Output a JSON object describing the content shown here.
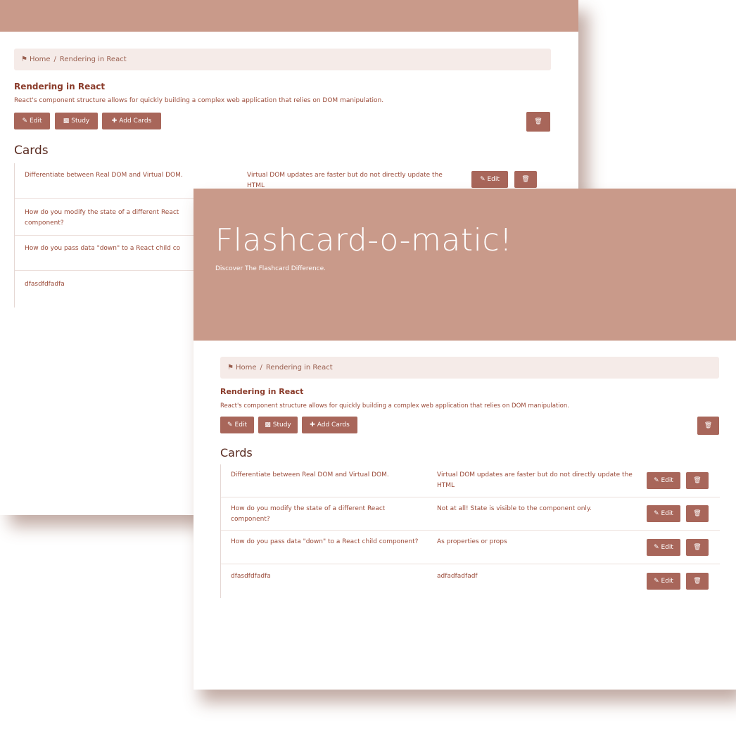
{
  "app": {
    "title": "Flashcard-o-matic!",
    "subtitle": "Discover The Flashcard Difference."
  },
  "breadcrumb": {
    "home_icon": "home-icon",
    "home": "Home",
    "separator": "/",
    "current": "Rendering in React"
  },
  "deck": {
    "name": "Rendering in React",
    "description": "React's component structure allows for quickly building a complex web application that relies on DOM manipulation.",
    "edit_label": "Edit",
    "study_label": "Study",
    "add_cards_label": "Add Cards",
    "delete_icon": "trash-icon"
  },
  "cards_heading": "Cards",
  "cards": [
    {
      "front": "Differentiate between Real DOM and Virtual DOM.",
      "back": "Virtual DOM updates are faster but do not directly update the HTML",
      "edit_label": "Edit"
    },
    {
      "front": "How do you modify the state of a different React component?",
      "back": "Not at all! State is visible to the component only.",
      "edit_label": "Edit"
    },
    {
      "front": "How do you pass data \"down\" to a React child component?",
      "back": "As properties or props",
      "edit_label": "Edit"
    },
    {
      "front": "dfasdfdfadfa",
      "back": "adfadfadfadf",
      "edit_label": "Edit"
    }
  ],
  "back_window_cards": [
    {
      "front": "Differentiate between Real DOM and Virtual DOM.",
      "back": "Virtual DOM updates are faster but do not directly update the HTML"
    },
    {
      "front": "How do you modify the state of a different React component?"
    },
    {
      "front": "How do you pass data \"down\" to a React child co"
    },
    {
      "front": "dfasdfdfadfa"
    }
  ],
  "colors": {
    "header": "#c99a8a",
    "button": "#a8665a",
    "breadcrumb_bg": "#f5ebe8",
    "text": "#9a4a38"
  }
}
